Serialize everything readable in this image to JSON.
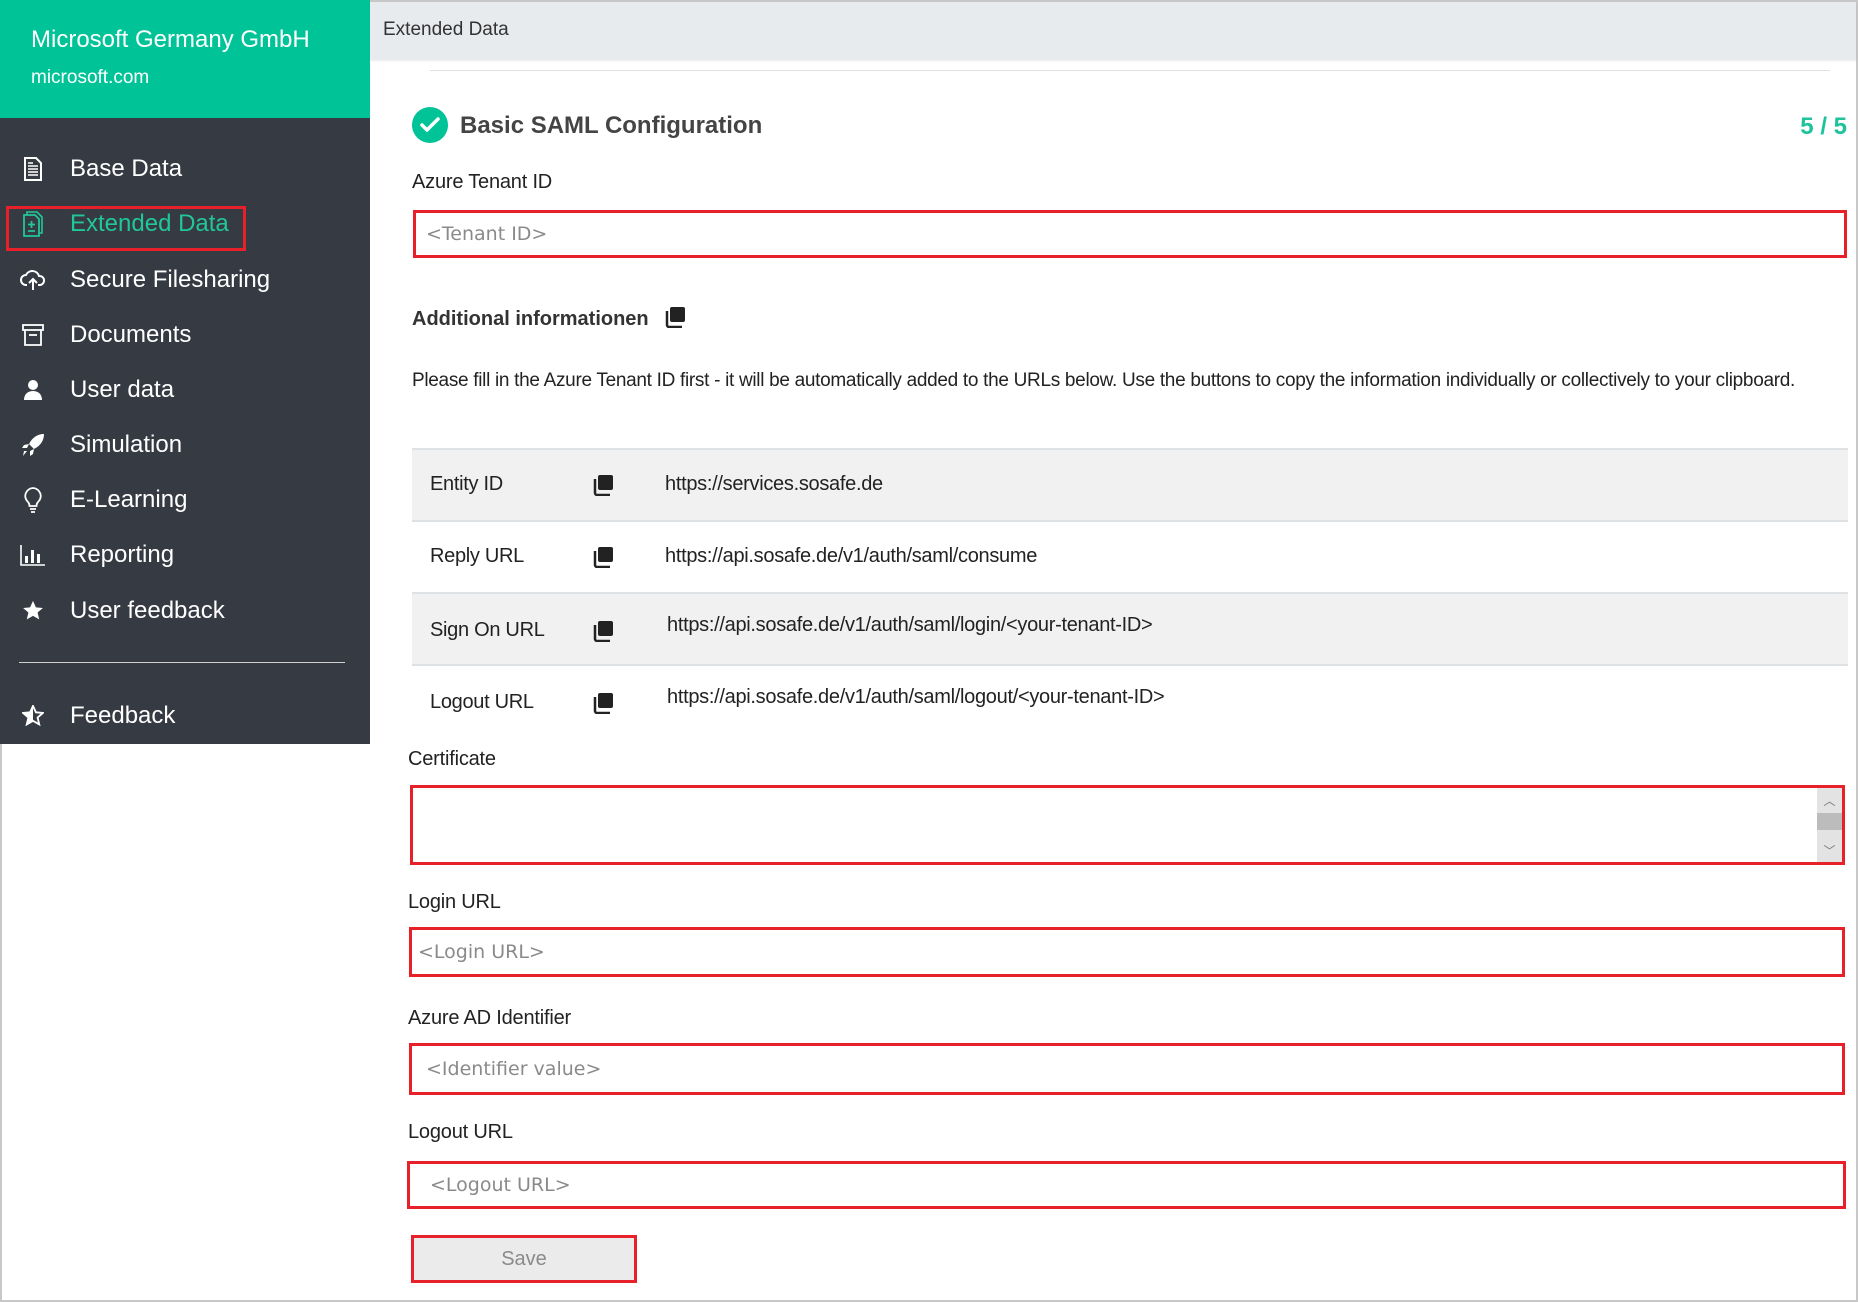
{
  "sidebar": {
    "company_name": "Microsoft Germany GmbH",
    "company_domain": "microsoft.com",
    "items": [
      {
        "label": "Base Data",
        "icon": "document-icon"
      },
      {
        "label": "Extended Data",
        "icon": "document-add-icon",
        "active": true
      },
      {
        "label": "Secure Filesharing",
        "icon": "cloud-upload-icon"
      },
      {
        "label": "Documents",
        "icon": "archive-box-icon"
      },
      {
        "label": "User data",
        "icon": "user-icon"
      },
      {
        "label": "Simulation",
        "icon": "rocket-icon"
      },
      {
        "label": "E-Learning",
        "icon": "lightbulb-icon"
      },
      {
        "label": "Reporting",
        "icon": "bar-chart-icon"
      },
      {
        "label": "User feedback",
        "icon": "star-icon"
      }
    ],
    "footer_item": {
      "label": "Feedback",
      "icon": "star-half-icon"
    }
  },
  "header": {
    "title": "Extended Data"
  },
  "section": {
    "title": "Basic SAML Configuration",
    "step": "5 / 5"
  },
  "form": {
    "tenant_label": "Azure Tenant ID",
    "tenant_placeholder": "<Tenant ID>",
    "additional_heading": "Additional informationen",
    "instructions": "Please fill in the Azure Tenant ID first - it will be automatically added to the URLs below. Use the buttons to copy the information individually or collectively to your clipboard.",
    "info_rows": [
      {
        "key": "Entity ID",
        "value": "https://services.sosafe.de"
      },
      {
        "key": "Reply URL",
        "value": "https://api.sosafe.de/v1/auth/saml/consume"
      },
      {
        "key": "Sign On URL",
        "value": "https://api.sosafe.de/v1/auth/saml/login/<your-tenant-ID>"
      },
      {
        "key": "Logout URL",
        "value": "https://api.sosafe.de/v1/auth/saml/logout/<your-tenant-ID>"
      }
    ],
    "certificate_label": "Certificate",
    "certificate_value": "",
    "login_url_label": "Login URL",
    "login_url_placeholder": "<Login URL>",
    "identifier_label": "Azure AD Identifier",
    "identifier_placeholder": "<Identifier value>",
    "logout_url_label": "Logout URL",
    "logout_url_placeholder": "<Logout URL>",
    "save_label": "Save"
  },
  "colors": {
    "brand": "#00c397",
    "sidebar_bg": "#363a42",
    "highlight": "#e8202a",
    "active_text": "#20c79a"
  }
}
